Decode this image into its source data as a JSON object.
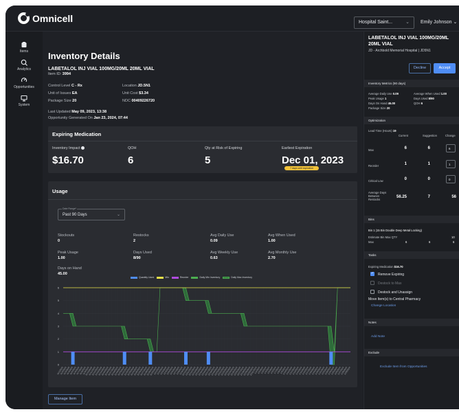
{
  "app": {
    "brand": "Omnicell",
    "hospital_select": "Hospital Saint...",
    "user_name": "Emily Johnson"
  },
  "sidebar": {
    "items": [
      {
        "label": "Items",
        "icon": "box-icon"
      },
      {
        "label": "Analytics",
        "icon": "magnify-chart-icon"
      },
      {
        "label": "Opportunities",
        "icon": "opportunities-icon"
      },
      {
        "label": "System",
        "icon": "monitor-icon"
      }
    ]
  },
  "details": {
    "title": "Inventory Details",
    "med_name": "LABETALOL INJ VIAL 100MG/20ML 20ML VIAL",
    "item_id_label": "Item ID:",
    "item_id": "3994",
    "control_level_label": "Control Level",
    "control_level": "C - Rx",
    "unit_of_issues_label": "Unit of Issues",
    "unit_of_issues": "EA",
    "package_size_label": "Package Size",
    "package_size": "20",
    "location_label": "Location",
    "location": "JD.5N1",
    "unit_cost_label": "Unit Cost",
    "unit_cost": "$3.34",
    "ndc_label": "NDC",
    "ndc": "00409226720",
    "last_updated_label": "Last Updated",
    "last_updated": "May 09, 2023, 13:38",
    "generated_label": "Opportunity Generated On",
    "generated": "Jan 23, 2024, 07:44"
  },
  "expiring": {
    "title": "Expiring Medication",
    "impact_label": "Inventory Impact",
    "impact": "$16.70",
    "qoh_label": "QOH",
    "qoh": "6",
    "risk_label": "Qty at Risk of Expiring",
    "risk": "5",
    "earliest_label": "Earliest Expiration",
    "earliest": "Dec 01, 2023",
    "badge": "7 days until expiration"
  },
  "usage": {
    "title": "Usage",
    "date_range_label": "Date Range*",
    "date_range": "Past 90 Days",
    "stats": [
      {
        "label": "Stockouts",
        "value": "0"
      },
      {
        "label": "Restocks",
        "value": "2"
      },
      {
        "label": "Avg Daily Use",
        "value": "0.09"
      },
      {
        "label": "Avg When Used",
        "value": "1.00"
      },
      {
        "label": "Peak Usage",
        "value": "1.00"
      },
      {
        "label": "Days Used",
        "value": "8/90"
      },
      {
        "label": "Avg Weekly Use",
        "value": "0.63"
      },
      {
        "label": "Avg Monthly Use",
        "value": "2.70"
      },
      {
        "label": "Days on Hand",
        "value": "45.00"
      }
    ],
    "manage_button": "Manage Item"
  },
  "chart_data": {
    "type": "line",
    "legend": [
      "Quantity Used",
      "Min",
      "Reorder",
      "Daily Min Inventory",
      "Daily Max Inventory"
    ],
    "colors": {
      "used": "#4f8df5",
      "min": "#e9e24a",
      "reorder": "#b04be0",
      "inv": "#4caf50",
      "band": "#2e6b3a"
    },
    "ylim": [
      0,
      6
    ],
    "yticks": [
      0,
      1,
      2,
      3,
      4,
      5,
      6
    ],
    "x": [
      "11/1/2023",
      "11/2/2023",
      "11/3/2023",
      "11/4/2023",
      "11/5/2023",
      "11/6/2023",
      "11/7/2023",
      "11/8/2023",
      "11/9/2023",
      "11/10/2023",
      "11/11/2023",
      "11/12/2023",
      "11/13/2023",
      "11/14/2023",
      "11/15/2023",
      "11/16/2023",
      "11/17/2023",
      "11/18/2023",
      "11/19/2023",
      "11/20/2023",
      "11/21/2023",
      "11/22/2023",
      "11/23/2023",
      "11/24/2023",
      "11/25/2023",
      "11/26/2023",
      "11/27/2023",
      "11/28/2023",
      "11/29/2023",
      "11/30/2023",
      "12/1/2023",
      "12/2/2023",
      "12/3/2023",
      "12/4/2023",
      "12/5/2023",
      "12/6/2023",
      "12/7/2023",
      "12/8/2023",
      "12/9/2023",
      "12/10/2023",
      "12/11/2023",
      "12/12/2023",
      "12/13/2023",
      "12/14/2023",
      "12/15/2023",
      "12/16/2023",
      "12/17/2023",
      "12/18/2023",
      "12/19/2023",
      "12/20/2023",
      "12/21/2023",
      "12/22/2023",
      "12/23/2023",
      "12/24/2023",
      "12/25/2023",
      "12/26/2023",
      "12/27/2023",
      "12/28/2023",
      "12/29/2023",
      "12/30/2023",
      "12/31/2023",
      "1/1/2024",
      "1/2/2024",
      "1/3/2024",
      "1/4/2024",
      "1/5/2024",
      "1/6/2024",
      "1/7/2024",
      "1/8/2024",
      "1/9/2024",
      "1/10/2024",
      "1/11/2024",
      "1/12/2024",
      "1/13/2024",
      "1/14/2024",
      "1/15/2024",
      "1/16/2024",
      "1/17/2024",
      "1/18/2024",
      "1/19/2024",
      "1/20/2024",
      "1/21/2024",
      "1/22/2024",
      "1/23/2024",
      "1/24/2024",
      "1/25/2024",
      "1/26/2024",
      "1/27/2024",
      "1/28/2024",
      "1/29/2024"
    ],
    "quantity_used": [
      0,
      0,
      0,
      1,
      0,
      0,
      0,
      0,
      0,
      0,
      0,
      0,
      0,
      0,
      0,
      0,
      0,
      0,
      0,
      1,
      0,
      0,
      0,
      0,
      0,
      0,
      0,
      1,
      0,
      0,
      0,
      0,
      0,
      0,
      0,
      0,
      0,
      0,
      1,
      0,
      0,
      0,
      0,
      0,
      0,
      1,
      0,
      0,
      0,
      0,
      0,
      0,
      0,
      0,
      0,
      0,
      0,
      0,
      0,
      0,
      0,
      0,
      0,
      0,
      0,
      0,
      0,
      0,
      0,
      0,
      0,
      0,
      0,
      0,
      0,
      0,
      0,
      0,
      0,
      0,
      0,
      0,
      0,
      1,
      0,
      0,
      0,
      0,
      0,
      0
    ],
    "min": [
      6,
      6,
      6,
      6,
      6,
      6,
      6,
      6,
      6,
      6,
      6,
      6,
      6,
      6,
      6,
      6,
      6,
      6,
      6,
      6,
      6,
      6,
      6,
      6,
      6,
      6,
      6,
      6,
      6,
      6,
      6,
      6,
      6,
      6,
      6,
      6,
      6,
      6,
      6,
      6,
      6,
      6,
      6,
      6,
      6,
      6,
      6,
      6,
      6,
      6,
      6,
      6,
      6,
      6,
      6,
      6,
      6,
      6,
      6,
      6,
      6,
      6,
      6,
      6,
      6,
      6,
      6,
      6,
      6,
      6,
      6,
      6,
      6,
      6,
      6,
      6,
      6,
      6,
      6,
      6,
      6,
      6,
      6,
      6,
      6,
      6,
      6,
      6,
      6,
      6
    ],
    "reorder": [
      1,
      1,
      1,
      1,
      1,
      1,
      1,
      1,
      1,
      1,
      1,
      1,
      1,
      1,
      1,
      1,
      1,
      1,
      1,
      1,
      1,
      1,
      1,
      1,
      1,
      1,
      1,
      1,
      1,
      1,
      1,
      1,
      1,
      1,
      1,
      1,
      1,
      1,
      1,
      1,
      1,
      1,
      1,
      1,
      1,
      1,
      1,
      1,
      1,
      1,
      1,
      1,
      1,
      1,
      1,
      1,
      1,
      1,
      1,
      1,
      1,
      1,
      1,
      1,
      1,
      1,
      1,
      1,
      1,
      1,
      1,
      1,
      1,
      1,
      1,
      1,
      1,
      1,
      1,
      1,
      1,
      1,
      1,
      1,
      1,
      1,
      1,
      1,
      1,
      1
    ],
    "daily_min": [
      4,
      4,
      4,
      3,
      3,
      3,
      3,
      3,
      3,
      3,
      3,
      3,
      3,
      3,
      3,
      3,
      3,
      3,
      3,
      2,
      2,
      2,
      2,
      2,
      2,
      2,
      2,
      1,
      1,
      1,
      6,
      6,
      6,
      6,
      6,
      6,
      6,
      6,
      5,
      5,
      5,
      5,
      5,
      5,
      5,
      4,
      4,
      4,
      4,
      4,
      4,
      4,
      4,
      4,
      4,
      4,
      3,
      3,
      3,
      3,
      3,
      3,
      3,
      3,
      3,
      3,
      3,
      3,
      3,
      3,
      3,
      3,
      3,
      3,
      3,
      3,
      3,
      3,
      3,
      3,
      3,
      3,
      3,
      0,
      0,
      6,
      6,
      6,
      6,
      6
    ],
    "daily_max": [
      4,
      4,
      4,
      4,
      3,
      3,
      3,
      3,
      3,
      3,
      3,
      3,
      3,
      3,
      3,
      3,
      3,
      3,
      3,
      3,
      2,
      2,
      2,
      2,
      2,
      2,
      2,
      2,
      1,
      1,
      6,
      6,
      6,
      6,
      6,
      6,
      6,
      6,
      6,
      5,
      5,
      5,
      5,
      5,
      5,
      5,
      4,
      4,
      4,
      4,
      4,
      4,
      4,
      4,
      4,
      4,
      4,
      3,
      3,
      3,
      3,
      3,
      3,
      3,
      3,
      3,
      3,
      3,
      3,
      3,
      3,
      3,
      3,
      3,
      3,
      3,
      3,
      3,
      3,
      3,
      3,
      3,
      3,
      3,
      1,
      6,
      6,
      6,
      6,
      6
    ]
  },
  "right": {
    "title": "LABETALOL INJ VIAL 100MG/20ML 20ML VIAL",
    "subtitle": "JD - Archbold Memorial Hospital | JD5N1",
    "decline": "Decline",
    "accept": "Accept",
    "metrics_hdr": "Inventory Metrics (90 days)",
    "m_avg_daily": "Average Daily Use",
    "m_avg_daily_v": "0.09",
    "m_peak": "Peak Usage",
    "m_peak_v": "1",
    "m_doh": "Days On Hand",
    "m_doh_v": "45.00",
    "m_pkg": "Package Size",
    "m_pkg_v": "20",
    "m_avg_when": "Average When Used",
    "m_avg_when_v": "1.00",
    "m_days_used": "Days Used",
    "m_days_used_v": "8/90",
    "m_qoh": "QOH",
    "m_qoh_v": "6",
    "opt_hdr": "Optimization",
    "lead_time": "Lead Time (Hours)",
    "lead_time_v": "19",
    "col_current": "Current",
    "col_suggestion": "Suggestion",
    "col_change": "Change",
    "rows": [
      {
        "label": "Max",
        "current": "6",
        "suggestion": "6",
        "change": "6"
      },
      {
        "label": "Reorder",
        "current": "1",
        "suggestion": "1",
        "change": "1"
      },
      {
        "label": "Critical Low",
        "current": "0",
        "suggestion": "0",
        "change": "0"
      }
    ],
    "avg_days_label": "Average Days Between Restocks",
    "avg_days_current": "56.25",
    "avg_days_suggestion": "7",
    "avg_days_change": "56",
    "bins_hdr": "Bins",
    "bin_name": "Bin 1 (15 Bin Double Deep Metal Locking)",
    "est_bin": "Estimate Bin Max QTY",
    "est_bin_v": "10",
    "bin_max": "Max",
    "bin_max_1": "6",
    "bin_max_2": "6",
    "bin_max_3": "6",
    "tasks_hdr": "Tasks",
    "task_exp": "Expiring Medication",
    "task_exp_v": "$16.70",
    "task1": "Remove Expiring",
    "task2": "Destock to Max",
    "task3": "Destock and Unassign",
    "task4": "Move Item(s) to Central Pharmacy",
    "change_location": "Change Location",
    "notes_hdr": "Notes",
    "add_note": "Add Note",
    "exclude_hdr": "Exclude",
    "exclude_link": "Exclude Item from Opportunities"
  }
}
